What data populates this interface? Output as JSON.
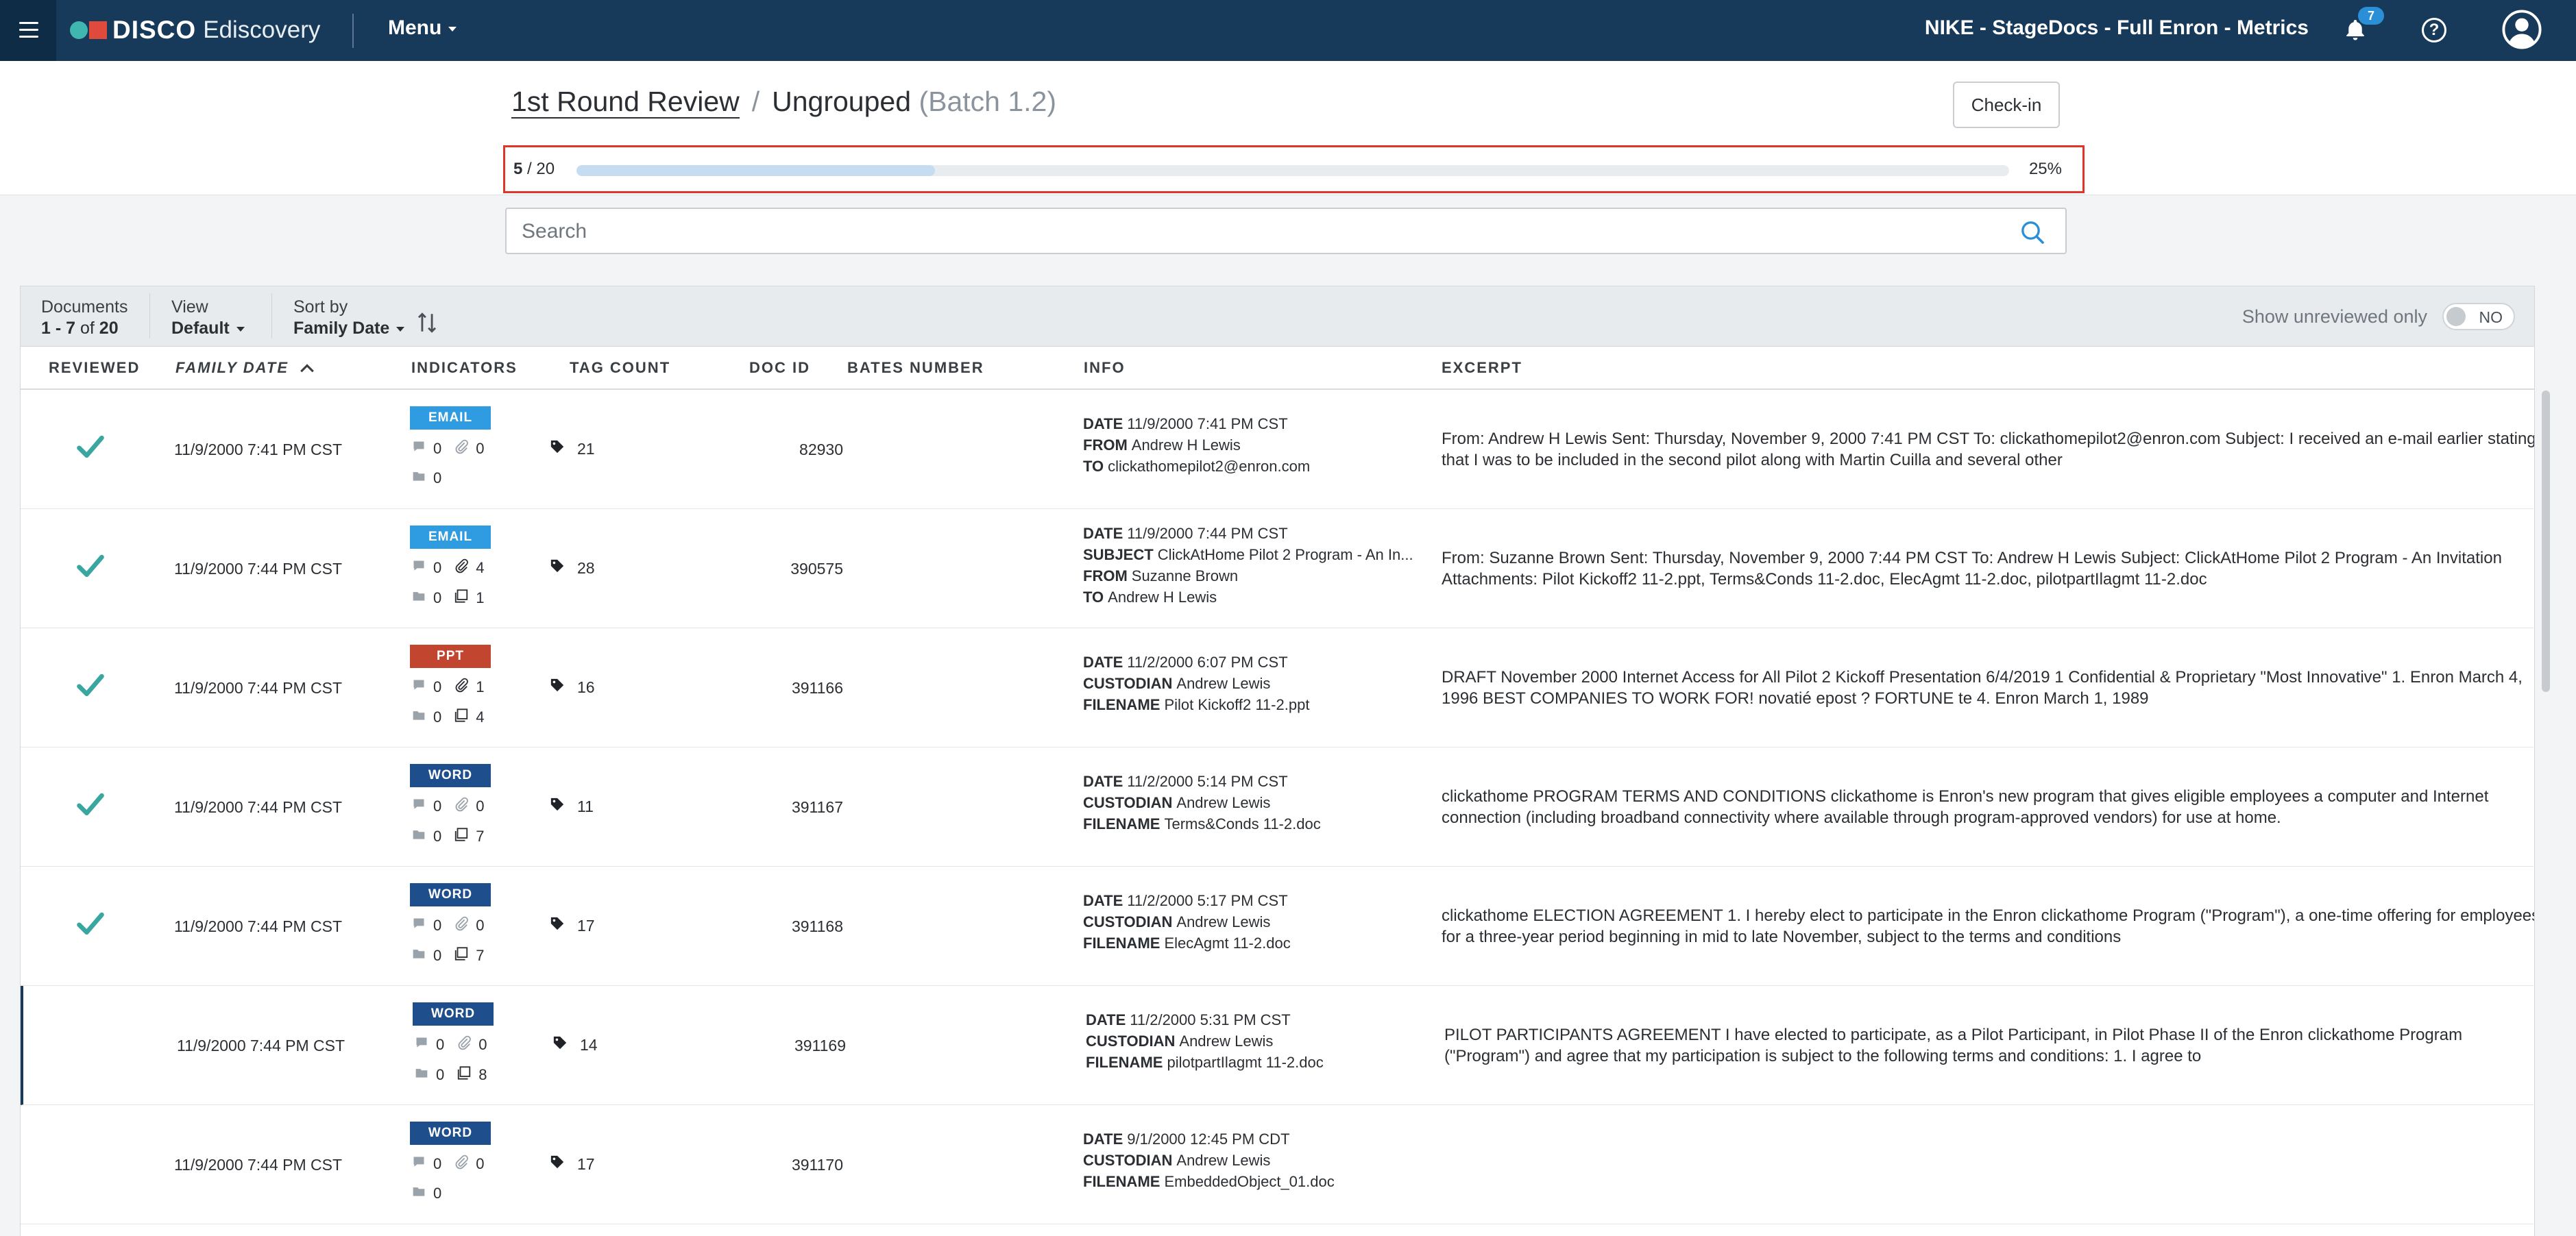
{
  "topbar": {
    "logo_brand": "DISCO",
    "logo_product": "Ediscovery",
    "menu_label": "Menu",
    "project_title": "NIKE - StageDocs - Full Enron - Metrics",
    "notification_count": "7"
  },
  "header": {
    "crumb_primary": "1st Round Review",
    "crumb_separator": "/",
    "crumb_secondary": "Ungrouped",
    "crumb_batch": "(Batch 1.2)",
    "checkin_label": "Check-in"
  },
  "progress": {
    "current": "5",
    "total": "/ 20",
    "percent_label": "25%",
    "fraction": 0.25
  },
  "search": {
    "placeholder": "Search"
  },
  "toolbar": {
    "documents_label": "Documents",
    "documents_range": "1 - 7",
    "documents_of": "of",
    "documents_total": "20",
    "view_label": "View",
    "view_value": "Default",
    "sort_label": "Sort by",
    "sort_value": "Family Date",
    "unreviewed_label": "Show unreviewed only",
    "unreviewed_toggle": "NO"
  },
  "columns": [
    "REVIEWED",
    "FAMILY DATE",
    "INDICATORS",
    "TAG COUNT",
    "DOC ID",
    "BATES NUMBER",
    "INFO",
    "EXCERPT"
  ],
  "type_colors": {
    "EMAIL": "#2f9be0",
    "PPT": "#c2462f",
    "WORD": "#1f4e8c"
  },
  "rows": [
    {
      "reviewed": true,
      "family_date": "11/9/2000 7:41 PM CST",
      "type": "EMAIL",
      "comments": "0",
      "attachments": "0",
      "attach_dim": true,
      "folders": "0",
      "pages": null,
      "tag_count": "21",
      "doc_id": "82930",
      "info": [
        [
          "DATE",
          "11/9/2000 7:41 PM CST"
        ],
        [
          "FROM",
          "Andrew H Lewis"
        ],
        [
          "TO",
          "clickathomepilot2@enron.com"
        ]
      ],
      "excerpt": "From: Andrew H Lewis Sent: Thursday, November 9, 2000 7:41 PM CST To: clickathomepilot2@enron.com Subject: I received an e-mail earlier stating that I was to be included in the second pilot along with Martin Cuilla and several other"
    },
    {
      "reviewed": true,
      "family_date": "11/9/2000 7:44 PM CST",
      "type": "EMAIL",
      "comments": "0",
      "attachments": "4",
      "attach_dim": false,
      "folders": "0",
      "pages": "1",
      "tag_count": "28",
      "doc_id": "390575",
      "info": [
        [
          "DATE",
          "11/9/2000 7:44 PM CST"
        ],
        [
          "SUBJECT",
          "ClickAtHome Pilot 2 Program - An In..."
        ],
        [
          "FROM",
          "Suzanne Brown"
        ],
        [
          "TO",
          "Andrew H Lewis"
        ]
      ],
      "excerpt": "From: Suzanne Brown Sent: Thursday, November 9, 2000 7:44 PM CST To: Andrew H Lewis Subject: ClickAtHome Pilot 2 Program - An Invitation Attachments: Pilot Kickoff2 11-2.ppt, Terms&Conds 11-2.doc, ElecAgmt 11-2.doc, pilotpartIlagmt 11-2.doc"
    },
    {
      "reviewed": true,
      "family_date": "11/9/2000 7:44 PM CST",
      "type": "PPT",
      "comments": "0",
      "attachments": "1",
      "attach_dim": false,
      "folders": "0",
      "pages": "4",
      "tag_count": "16",
      "doc_id": "391166",
      "info": [
        [
          "DATE",
          "11/2/2000 6:07 PM CST"
        ],
        [
          "CUSTODIAN",
          "Andrew Lewis"
        ],
        [
          "FILENAME",
          "Pilot Kickoff2 11-2.ppt"
        ]
      ],
      "excerpt": "DRAFT November 2000 Internet Access for All Pilot 2 Kickoff Presentation 6/4/2019 1 Confidential & Proprietary \"Most Innovative\" 1. Enron March 4, 1996 BEST COMPANIES TO WORK FOR! novatié epost ? FORTUNE te 4. Enron March 1, 1989"
    },
    {
      "reviewed": true,
      "family_date": "11/9/2000 7:44 PM CST",
      "type": "WORD",
      "comments": "0",
      "attachments": "0",
      "attach_dim": true,
      "folders": "0",
      "pages": "7",
      "tag_count": "11",
      "doc_id": "391167",
      "info": [
        [
          "DATE",
          "11/2/2000 5:14 PM CST"
        ],
        [
          "CUSTODIAN",
          "Andrew Lewis"
        ],
        [
          "FILENAME",
          "Terms&Conds 11-2.doc"
        ]
      ],
      "excerpt": "clickathome PROGRAM TERMS AND CONDITIONS clickathome is Enron's new program that gives eligible employees a computer and Internet connection (including broadband connectivity where available through program-approved vendors) for use at home."
    },
    {
      "reviewed": true,
      "family_date": "11/9/2000 7:44 PM CST",
      "type": "WORD",
      "comments": "0",
      "attachments": "0",
      "attach_dim": true,
      "folders": "0",
      "pages": "7",
      "tag_count": "17",
      "doc_id": "391168",
      "info": [
        [
          "DATE",
          "11/2/2000 5:17 PM CST"
        ],
        [
          "CUSTODIAN",
          "Andrew Lewis"
        ],
        [
          "FILENAME",
          "ElecAgmt 11-2.doc"
        ]
      ],
      "excerpt": "clickathome ELECTION AGREEMENT 1. I hereby elect to participate in the Enron clickathome Program (\"Program\"), a one-time offering for employees for a three-year period beginning in mid to late November, subject to the terms and conditions"
    },
    {
      "reviewed": false,
      "active": true,
      "family_date": "11/9/2000 7:44 PM CST",
      "type": "WORD",
      "comments": "0",
      "attachments": "0",
      "attach_dim": true,
      "folders": "0",
      "pages": "8",
      "tag_count": "14",
      "doc_id": "391169",
      "info": [
        [
          "DATE",
          "11/2/2000 5:31 PM CST"
        ],
        [
          "CUSTODIAN",
          "Andrew Lewis"
        ],
        [
          "FILENAME",
          "pilotpartIlagmt 11-2.doc"
        ]
      ],
      "excerpt": "PILOT PARTICIPANTS AGREEMENT I have elected to participate, as a Pilot Participant, in Pilot Phase II of the Enron clickathome Program (\"Program\") and agree that my participation is subject to the following terms and conditions: 1. I agree to"
    },
    {
      "reviewed": false,
      "family_date": "11/9/2000 7:44 PM CST",
      "type": "WORD",
      "comments": "0",
      "attachments": "0",
      "attach_dim": true,
      "folders": "0",
      "pages": null,
      "tag_count": "17",
      "doc_id": "391170",
      "info": [
        [
          "DATE",
          "9/1/2000 12:45 PM CDT"
        ],
        [
          "CUSTODIAN",
          "Andrew Lewis"
        ],
        [
          "FILENAME",
          "EmbeddedObject_01.doc"
        ]
      ],
      "excerpt": ""
    }
  ]
}
